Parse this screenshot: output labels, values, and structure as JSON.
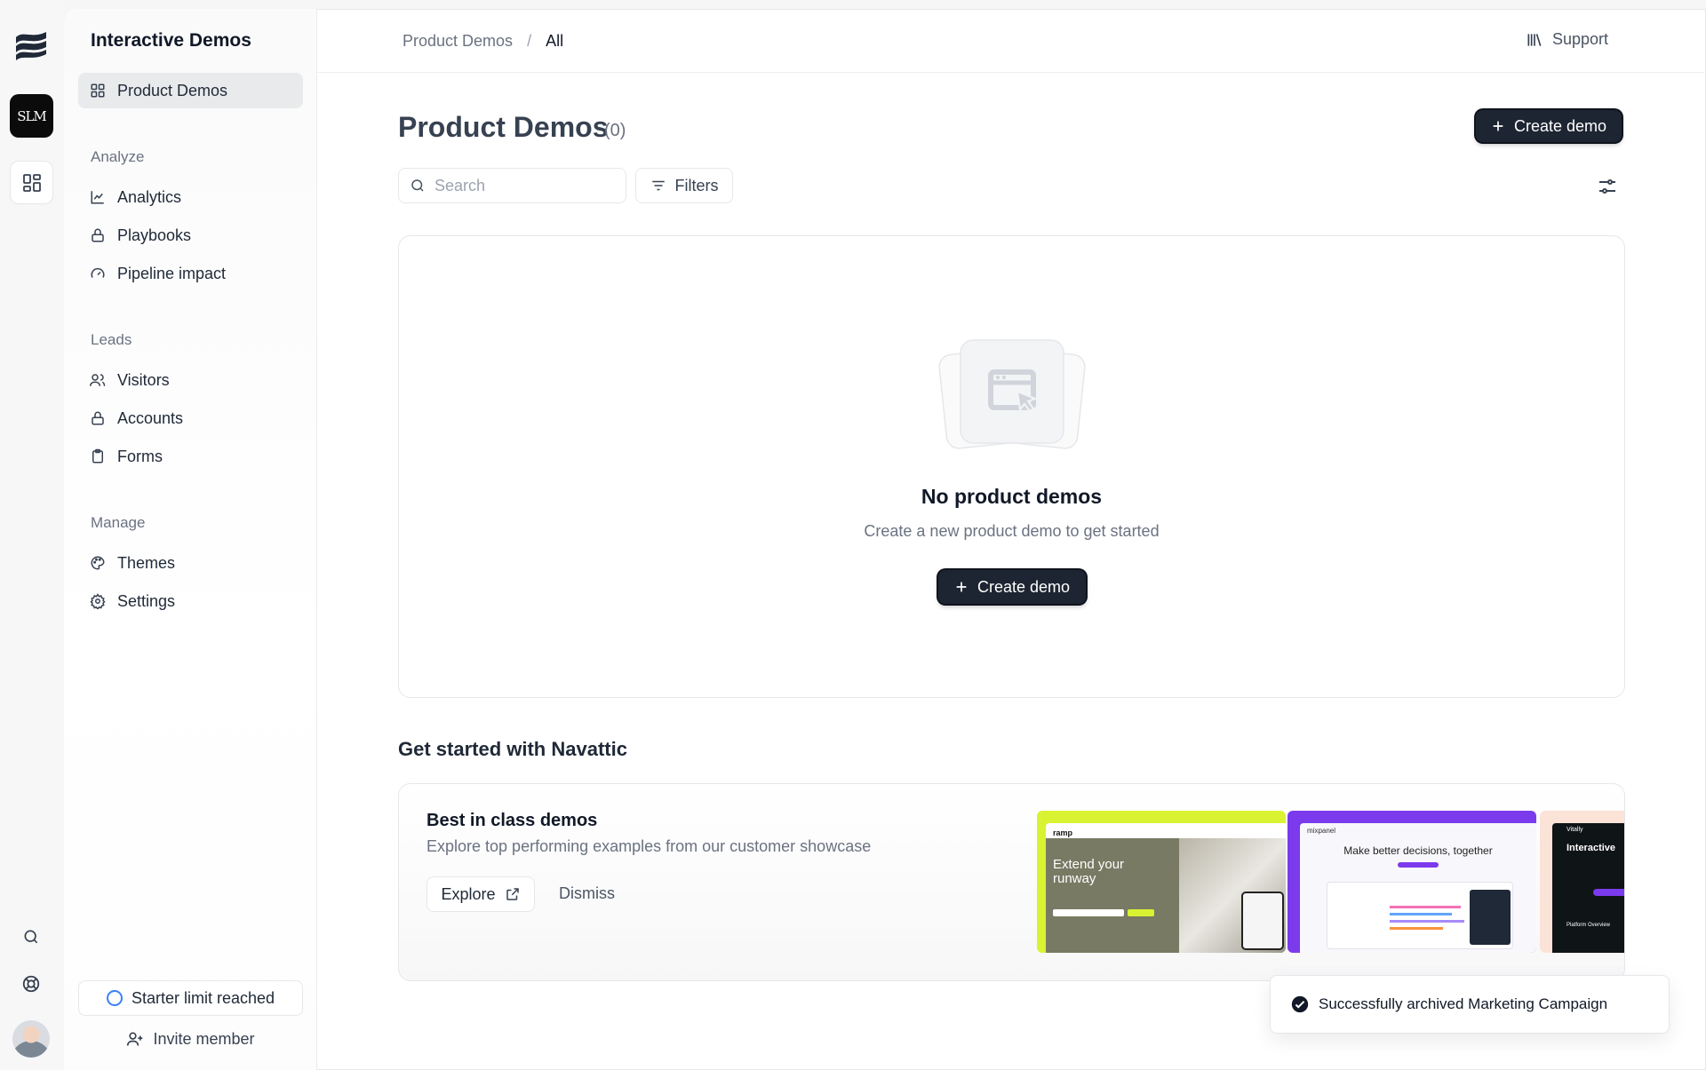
{
  "rail": {
    "workspace_badge": "SLM"
  },
  "sidebar": {
    "title": "Interactive Demos",
    "active_item": "Product Demos",
    "sections": [
      {
        "label": "Analyze"
      },
      {
        "label": "Leads"
      },
      {
        "label": "Manage"
      }
    ],
    "items": {
      "analytics": "Analytics",
      "playbooks": "Playbooks",
      "pipeline": "Pipeline impact",
      "visitors": "Visitors",
      "accounts": "Accounts",
      "forms": "Forms",
      "themes": "Themes",
      "settings": "Settings"
    },
    "starter_limit": "Starter limit reached",
    "invite": "Invite member"
  },
  "topbar": {
    "breadcrumb": [
      "Product Demos",
      "All"
    ],
    "separator": "/",
    "support": "Support"
  },
  "main": {
    "title": "Product Demos",
    "count": "(0)",
    "create_label": "Create demo",
    "search_placeholder": "Search",
    "filters_label": "Filters",
    "empty": {
      "title": "No product demos",
      "subtitle": "Create a new product demo to get started",
      "button": "Create demo"
    },
    "get_started": {
      "title": "Get started with Navattic",
      "card_title": "Best in class demos",
      "card_subtitle": "Explore top performing examples from our customer showcase",
      "explore": "Explore",
      "dismiss": "Dismiss",
      "thumbnails": {
        "ramp": {
          "brand": "ramp",
          "headline": "Extend your runway",
          "accent": "#d9f232"
        },
        "mixpanel": {
          "brand": "mixpanel",
          "headline": "Make better decisions, together",
          "accent": "#7c3aed"
        },
        "vitally": {
          "brand": "Vitally",
          "headline": "Interactive",
          "caption": "Platform Overview",
          "accent": "#fbe3d7"
        }
      }
    }
  },
  "toast": {
    "message": "Successfully archived Marketing Campaign"
  },
  "colors": {
    "primary_button": "#1e2532",
    "active_nav_bg": "#e9eaec",
    "starter_ring": "#3b82f6"
  }
}
